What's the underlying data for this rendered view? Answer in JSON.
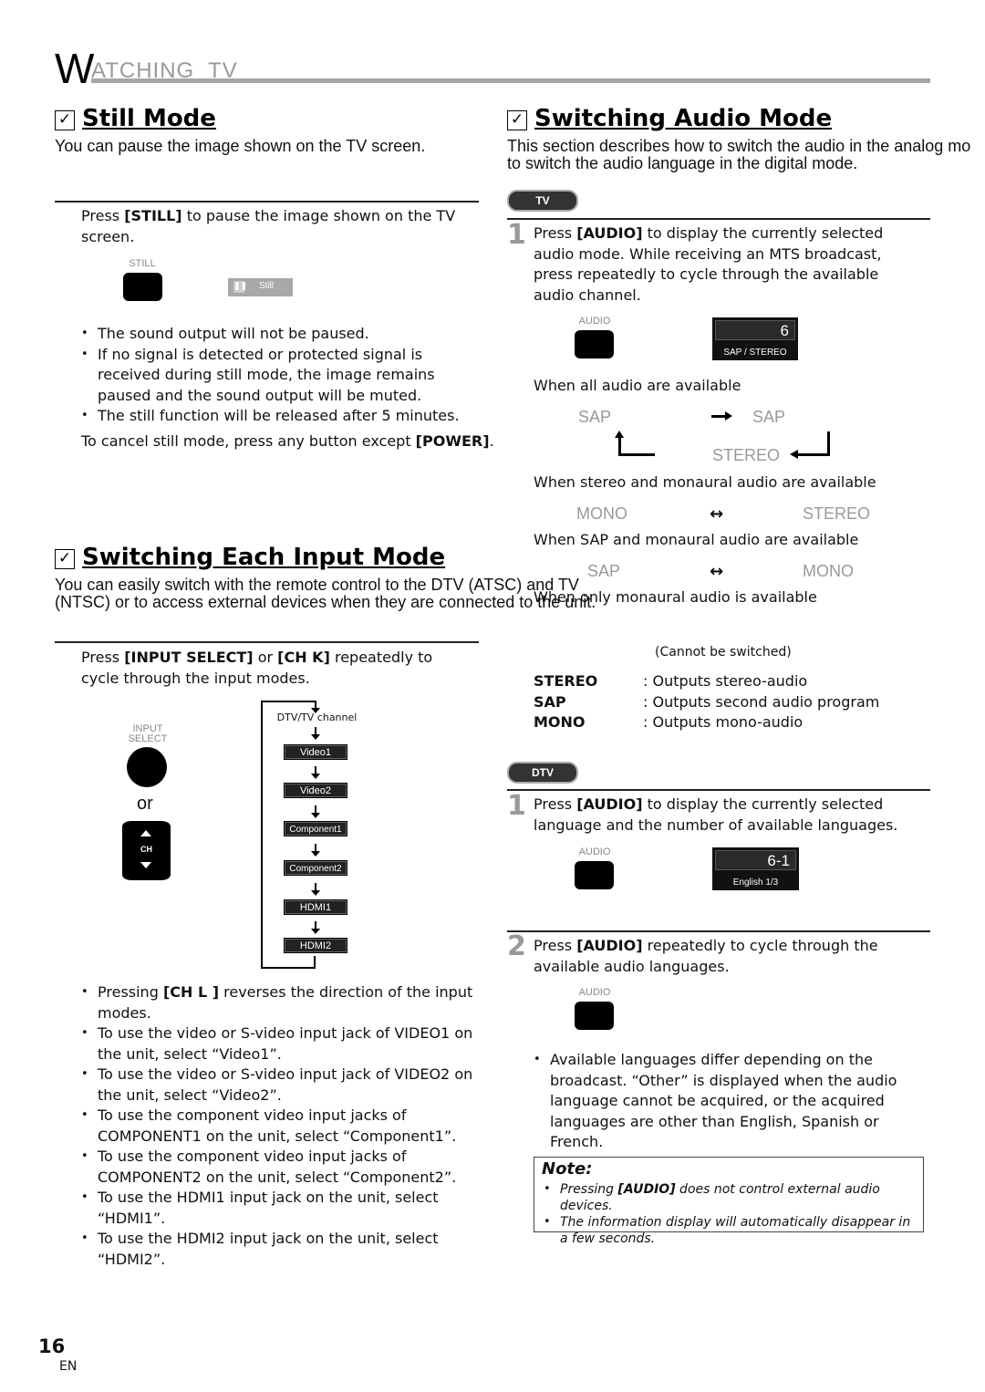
{
  "header": {
    "initial": "W",
    "rest": "ATCHING  TV"
  },
  "still_mode": {
    "title": "Still Mode",
    "intro": "You can pause the image shown on the TV screen.",
    "step_prefix": "Press ",
    "step_key": "[STILL]",
    "step_suffix": " to pause the image shown on the TV screen.",
    "button_label": "STILL",
    "osd_label": "Still",
    "bullets": [
      "The sound output will not be paused.",
      "If no signal is detected or protected signal is received during still mode, the image remains paused and the sound output will be muted.",
      "The still function will be released after 5 minutes."
    ],
    "cancel_prefix": "To cancel still mode, press any button except ",
    "cancel_key": "[POWER]",
    "cancel_suffix": "."
  },
  "input_mode": {
    "title": "Switching Each Input Mode",
    "intro_line1": "You can easily switch with the remote control to the DTV (ATSC) and TV",
    "intro_line2": "(NTSC) or to access external devices when they are connected to the unit.",
    "step_prefix": "Press ",
    "step_key1": "[INPUT SELECT]",
    "step_mid": " or ",
    "step_key2": "[CH K]",
    "step_suffix": " repeatedly to cycle through the input modes.",
    "button_label": "INPUT SELECT",
    "or_label": "or",
    "ch_label": "CH",
    "flow_start": "DTV/TV channel",
    "flow": [
      "Video1",
      "Video2",
      "Component1",
      "Component2",
      "HDMI1",
      "HDMI2"
    ],
    "bullet_first_prefix": "Pressing ",
    "bullet_first_key": "[CH L ]",
    "bullet_first_suffix": " reverses the direction of the input modes.",
    "bullets": [
      "To use the video or S-video input jack of VIDEO1 on the unit, select “Video1”.",
      "To use the video or S-video input jack of VIDEO2 on the unit, select “Video2”.",
      "To use the component video input jacks of COMPONENT1 on the unit, select “Component1”.",
      "To use the component video input jacks of COMPONENT2 on the unit, select “Component2”.",
      "To use the HDMI1 input jack on the unit, select “HDMI1”.",
      "To use the HDMI2 input jack on the unit, select “HDMI2”."
    ]
  },
  "audio_mode": {
    "title": "Switching Audio Mode",
    "intro_line1": "This section describes how to switch the audio in the analog mo",
    "intro_line2": "to switch the audio language in the digital mode.",
    "tv_badge": "TV",
    "tv_step_num": "1",
    "tv_step_prefix": "Press ",
    "tv_step_key": "[AUDIO]",
    "tv_step_suffix": " to display the currently selected audio mode. While receiving an MTS broadcast, press repeatedly to cycle through the available audio channel.",
    "audio_button_label": "AUDIO",
    "osd_tv": {
      "channel": "6",
      "status": "SAP / STEREO"
    },
    "case_all": "When all audio are available",
    "case_all_modes": [
      "SAP",
      "SAP",
      "STEREO"
    ],
    "case_stereo_mono": "When stereo and monaural audio are available",
    "case_stereo_mono_modes": [
      "MONO",
      "STEREO"
    ],
    "case_sap_mono": "When SAP and monaural audio are available",
    "case_sap_mono_modes": [
      "SAP",
      "MONO"
    ],
    "case_mono_only": "When only monaural audio is available",
    "cannot_switch": "(Cannot be switched)",
    "definitions": [
      {
        "term": "STEREO",
        "desc": ": Outputs stereo-audio"
      },
      {
        "term": "SAP",
        "desc": ": Outputs second audio program"
      },
      {
        "term": "MONO",
        "desc": ": Outputs mono-audio"
      }
    ],
    "dtv_badge": "DTV",
    "dtv_step1_num": "1",
    "dtv_step1_prefix": "Press ",
    "dtv_step1_key": "[AUDIO]",
    "dtv_step1_suffix": " to display the currently selected language and the number of available languages.",
    "osd_dtv": {
      "channel": "6-1",
      "status": "English 1/3"
    },
    "dtv_step2_num": "2",
    "dtv_step2_prefix": "Press ",
    "dtv_step2_key": "[AUDIO]",
    "dtv_step2_suffix": " repeatedly to cycle through the available audio languages.",
    "bullet": "Available languages differ depending on the broadcast. “Other” is displayed when the audio language cannot be acquired, or the acquired languages are other than English, Spanish or French.",
    "note": {
      "title": "Note:",
      "item1_prefix": "Pressing ",
      "item1_key": "[AUDIO]",
      "item1_suffix": " does not control external audio devices.",
      "item2": "The information display will automatically disappear in a few seconds."
    }
  },
  "footer": {
    "page_number": "16",
    "language": "EN"
  }
}
